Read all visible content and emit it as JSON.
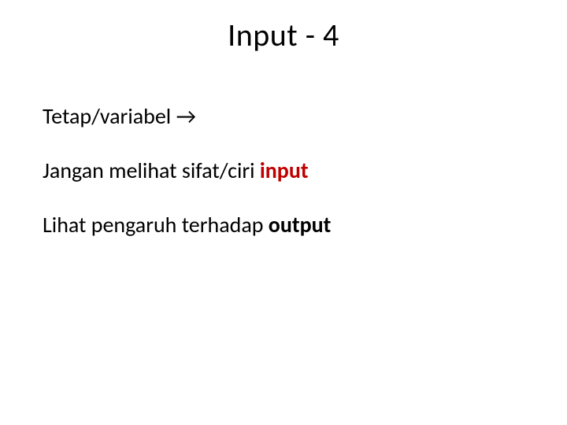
{
  "slide": {
    "title": "Input - 4",
    "line1": {
      "text": "Tetap/variabel ",
      "arrow": "→"
    },
    "line2": {
      "prefix": "Jangan melihat sifat/ciri ",
      "emph": "input"
    },
    "line3": {
      "prefix": "Lihat pengaruh terhadap ",
      "emph": "output"
    }
  }
}
